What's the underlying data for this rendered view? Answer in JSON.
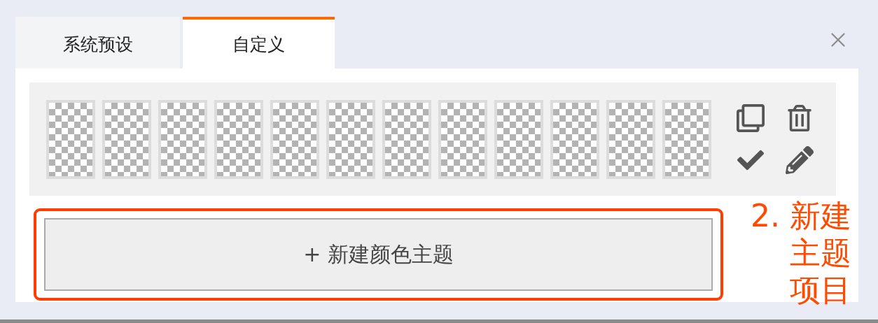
{
  "tabs": [
    {
      "label": "系统预设",
      "selected": false
    },
    {
      "label": "自定义",
      "selected": true
    }
  ],
  "swatches": [
    {
      "kind": "transparent"
    },
    {
      "kind": "transparent"
    },
    {
      "kind": "transparent"
    },
    {
      "kind": "transparent"
    },
    {
      "kind": "transparent"
    },
    {
      "kind": "transparent"
    },
    {
      "kind": "transparent"
    },
    {
      "kind": "transparent"
    },
    {
      "kind": "transparent"
    },
    {
      "kind": "transparent"
    },
    {
      "kind": "transparent"
    },
    {
      "kind": "transparent"
    }
  ],
  "new_theme_button": {
    "label": "+ 新建颜色主题",
    "highlighted": true
  },
  "annotation": {
    "lines": [
      "2. 新建",
      "主题",
      "项目"
    ]
  }
}
